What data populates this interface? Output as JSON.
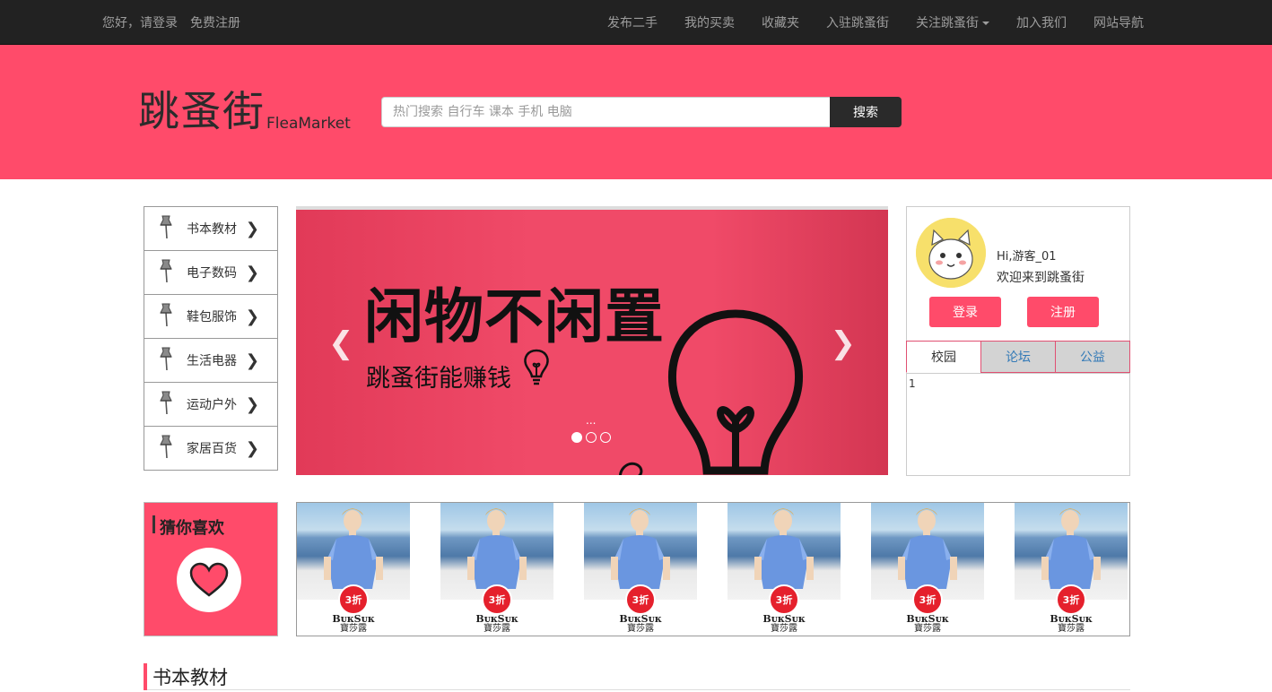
{
  "topnav": {
    "greeting": "您好，请登录",
    "register": "免费注册",
    "links": [
      "发布二手",
      "我的买卖",
      "收藏夹",
      "入驻跳蚤街",
      "关注跳蚤街",
      "加入我们",
      "网站导航"
    ]
  },
  "logo": {
    "cn": "跳蚤街",
    "en": "FleaMarket"
  },
  "search": {
    "placeholder": "热门搜索 自行车 课本 手机 电脑",
    "button": "搜索"
  },
  "categories": [
    "书本教材",
    "电子数码",
    "鞋包服饰",
    "生活电器",
    "运动户外",
    "家居百货"
  ],
  "carousel": {
    "headline": "闲物不闲置",
    "subtitle": "跳蚤街能赚钱",
    "ellipsis": "...",
    "slide_count": 3,
    "active_slide": 1
  },
  "user": {
    "hi": "Hi,游客_01",
    "welcome": "欢迎来到跳蚤街",
    "login": "登录",
    "register": "注册",
    "tabs": [
      "校园",
      "论坛",
      "公益"
    ],
    "tab_content": "1"
  },
  "guess": {
    "title": "猜你喜欢"
  },
  "products": [
    {
      "badge": "3折",
      "brand": "BᴜᴋSᴜᴋ",
      "brand_cn": "寶莎露"
    },
    {
      "badge": "3折",
      "brand": "BᴜᴋSᴜᴋ",
      "brand_cn": "寶莎露"
    },
    {
      "badge": "3折",
      "brand": "BᴜᴋSᴜᴋ",
      "brand_cn": "寶莎露"
    },
    {
      "badge": "3折",
      "brand": "BᴜᴋSᴜᴋ",
      "brand_cn": "寶莎露"
    },
    {
      "badge": "3折",
      "brand": "BᴜᴋSᴜᴋ",
      "brand_cn": "寶莎露"
    },
    {
      "badge": "3折",
      "brand": "BᴜᴋSᴜᴋ",
      "brand_cn": "寶莎露"
    }
  ],
  "section": {
    "title": "书本教材"
  },
  "colors": {
    "brand": "#ff4b6a",
    "nav": "#222222",
    "badge": "#e5202c"
  },
  "icons": {
    "category": "pushpin-icon",
    "chevron": "chevron-right-icon",
    "guess": "heart-icon",
    "bulb": "lightbulb-icon"
  }
}
